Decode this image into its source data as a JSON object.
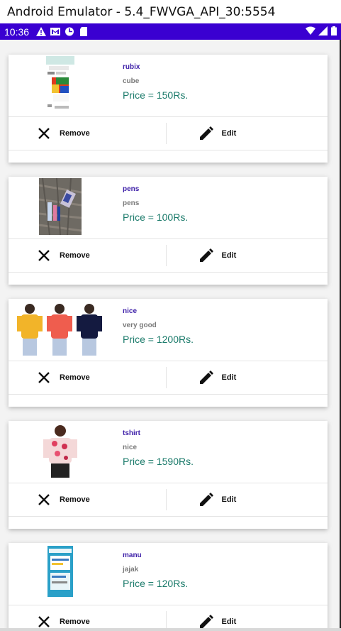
{
  "window": {
    "title": "Android Emulator - 5.4_FWVGA_API_30:5554"
  },
  "statusbar": {
    "time": "10:36"
  },
  "products": [
    {
      "name": "rubix",
      "desc": "cube",
      "price": "Price = 150Rs.",
      "remove_label": "Remove",
      "edit_label": "Edit"
    },
    {
      "name": "pens",
      "desc": "pens",
      "price": "Price = 100Rs.",
      "remove_label": "Remove",
      "edit_label": "Edit"
    },
    {
      "name": "nice",
      "desc": "very good",
      "price": "Price = 1200Rs.",
      "remove_label": "Remove",
      "edit_label": "Edit"
    },
    {
      "name": "tshirt",
      "desc": "nice",
      "price": "Price = 1590Rs.",
      "remove_label": "Remove",
      "edit_label": "Edit"
    },
    {
      "name": "manu",
      "desc": "jajak",
      "price": "Price = 120Rs.",
      "remove_label": "Remove",
      "edit_label": "Edit"
    }
  ],
  "colors": {
    "statusbar": "#3a00d1",
    "name": "#3d1fa8",
    "price": "#1a7a6a"
  }
}
